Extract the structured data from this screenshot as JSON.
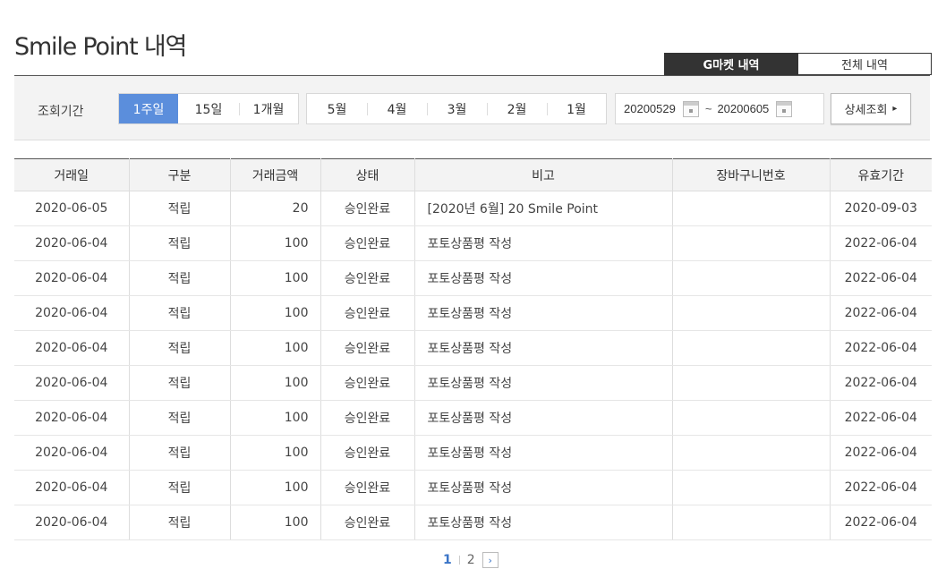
{
  "title": "Smile Point 내역",
  "tabs": [
    {
      "label": "G마켓 내역",
      "active": true
    },
    {
      "label": "전체 내역",
      "active": false
    }
  ],
  "search": {
    "label": "조회기간",
    "relative_periods": [
      {
        "label": "1주일",
        "active": true
      },
      {
        "label": "15일",
        "active": false
      },
      {
        "label": "1개월",
        "active": false
      }
    ],
    "months": [
      "5월",
      "4월",
      "3월",
      "2월",
      "1월"
    ],
    "date_from": "20200529",
    "date_sep": "~",
    "date_to": "20200605",
    "detail_button": "상세조회",
    "detail_icon": "▸"
  },
  "table": {
    "headers": [
      "거래일",
      "구분",
      "거래금액",
      "상태",
      "비고",
      "장바구니번호",
      "유효기간"
    ],
    "rows": [
      [
        "2020-06-05",
        "적립",
        "20",
        "승인완료",
        "[2020년 6월] 20 Smile Point",
        "",
        "2020-09-03"
      ],
      [
        "2020-06-04",
        "적립",
        "100",
        "승인완료",
        "포토상품평 작성",
        "",
        "2022-06-04"
      ],
      [
        "2020-06-04",
        "적립",
        "100",
        "승인완료",
        "포토상품평 작성",
        "",
        "2022-06-04"
      ],
      [
        "2020-06-04",
        "적립",
        "100",
        "승인완료",
        "포토상품평 작성",
        "",
        "2022-06-04"
      ],
      [
        "2020-06-04",
        "적립",
        "100",
        "승인완료",
        "포토상품평 작성",
        "",
        "2022-06-04"
      ],
      [
        "2020-06-04",
        "적립",
        "100",
        "승인완료",
        "포토상품평 작성",
        "",
        "2022-06-04"
      ],
      [
        "2020-06-04",
        "적립",
        "100",
        "승인완료",
        "포토상품평 작성",
        "",
        "2022-06-04"
      ],
      [
        "2020-06-04",
        "적립",
        "100",
        "승인완료",
        "포토상품평 작성",
        "",
        "2022-06-04"
      ],
      [
        "2020-06-04",
        "적립",
        "100",
        "승인완료",
        "포토상품평 작성",
        "",
        "2022-06-04"
      ],
      [
        "2020-06-04",
        "적립",
        "100",
        "승인완료",
        "포토상품평 작성",
        "",
        "2022-06-04"
      ]
    ]
  },
  "pagination": {
    "pages": [
      "1",
      "2"
    ],
    "current": "1",
    "next_icon": "›"
  },
  "colors": {
    "accent": "#5b8edc",
    "tab_active_bg": "#333333",
    "page_current": "#3a74c7"
  }
}
